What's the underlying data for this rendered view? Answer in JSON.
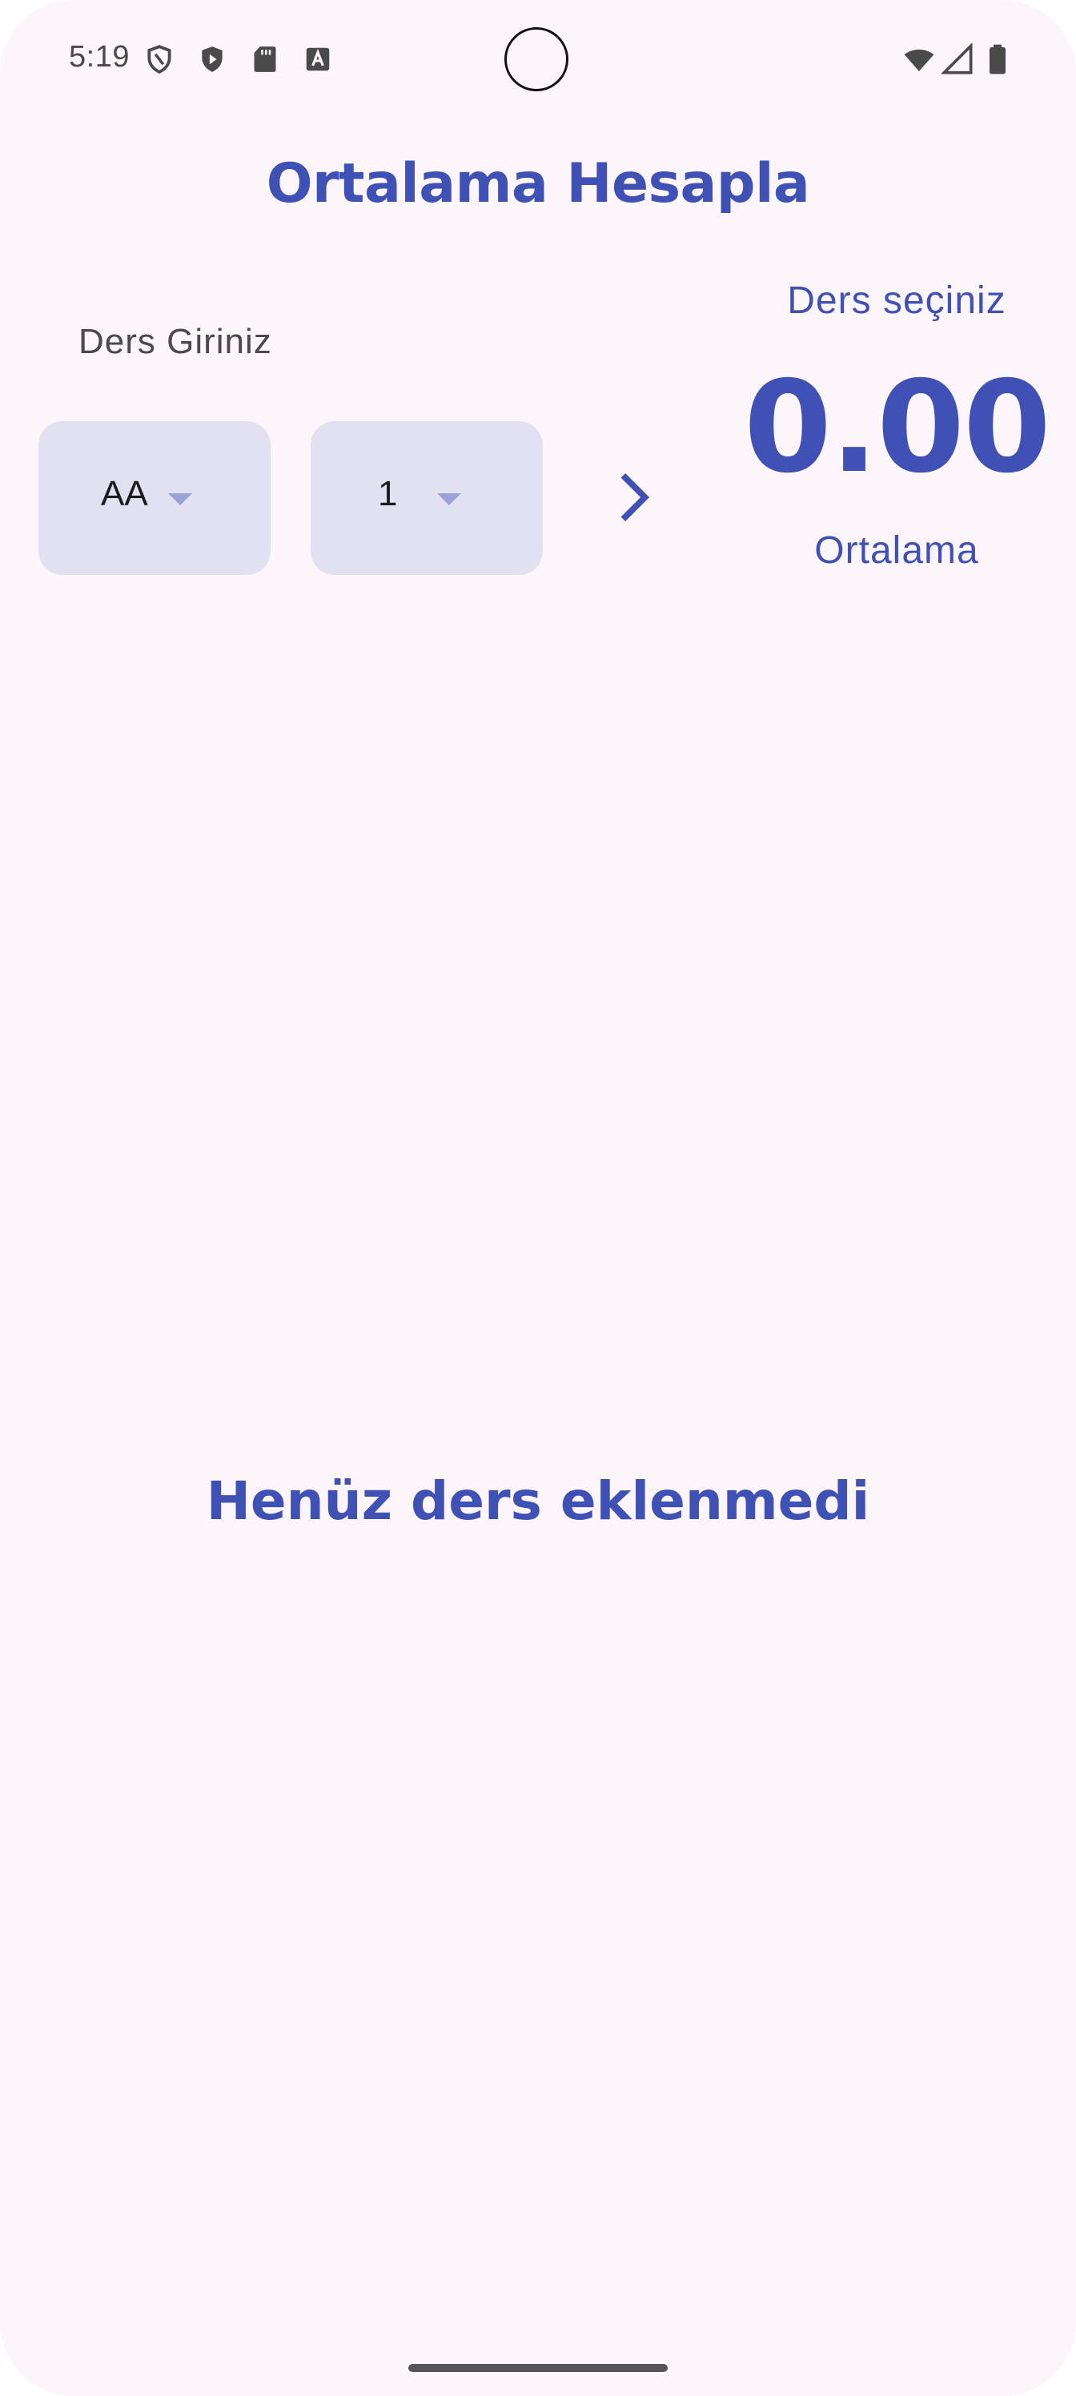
{
  "status_bar": {
    "time": "5:19",
    "left_icons": [
      "shield-outline-icon",
      "shield-play-icon",
      "sd-card-icon",
      "font-a-icon"
    ],
    "right_icons": [
      "wifi-icon",
      "signal-icon",
      "battery-icon"
    ]
  },
  "header": {
    "title": "Ortalama Hesapla"
  },
  "form": {
    "course_label": "Ders Giriniz",
    "grade_dropdown": {
      "selected": "AA"
    },
    "credit_dropdown": {
      "selected": "1"
    },
    "add_icon": "chevron-right-icon"
  },
  "summary": {
    "label": "Ders seçiniz",
    "average_value": "0.00",
    "caption": "Ortalama"
  },
  "list": {
    "empty_message": "Henüz ders eklenmedi"
  },
  "colors": {
    "primary": "#3f51b5",
    "background": "#fcf5fb",
    "dropdown_fill": "#e1e1f2"
  }
}
